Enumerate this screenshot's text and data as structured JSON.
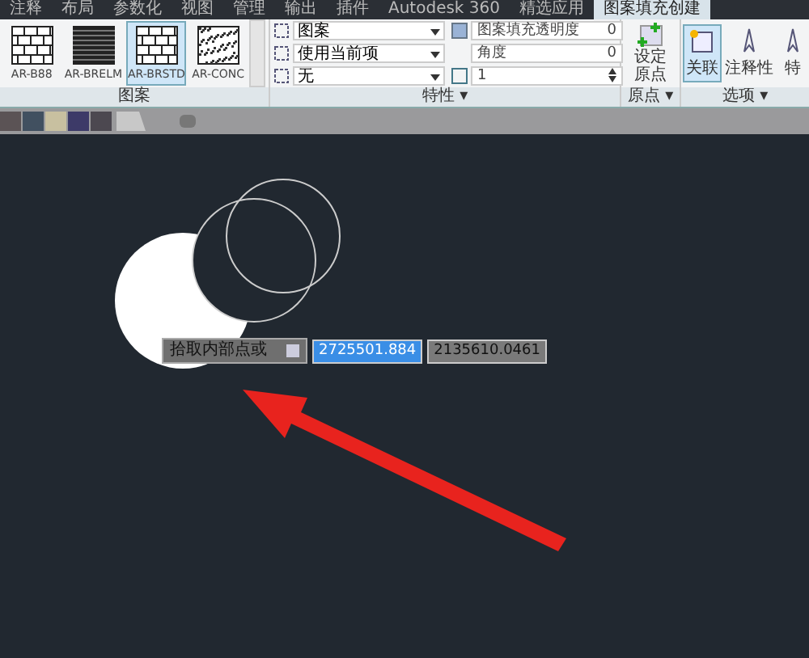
{
  "ribbon_tabs": [
    {
      "label": "注释",
      "selected": false
    },
    {
      "label": "布局",
      "selected": false
    },
    {
      "label": "参数化",
      "selected": false
    },
    {
      "label": "视图",
      "selected": false
    },
    {
      "label": "管理",
      "selected": false
    },
    {
      "label": "输出",
      "selected": false
    },
    {
      "label": "插件",
      "selected": false
    },
    {
      "label": "Autodesk 360",
      "selected": false
    },
    {
      "label": "精选应用",
      "selected": false
    },
    {
      "label": "图案填充创建",
      "selected": true
    }
  ],
  "pattern_panel": {
    "title": "图案",
    "patterns": [
      {
        "label": "AR-B88",
        "selected": false,
        "kind": "brick"
      },
      {
        "label": "AR-BRELM",
        "selected": false,
        "kind": "dense"
      },
      {
        "label": "AR-BRSTD",
        "selected": true,
        "kind": "brick"
      },
      {
        "label": "AR-CONC",
        "selected": false,
        "kind": "concrete"
      }
    ]
  },
  "properties_panel": {
    "title": "特性 ▾",
    "dropdowns": [
      "图案",
      "使用当前项",
      "无"
    ],
    "transparency_label": "图案填充透明度",
    "transparency_value": "0",
    "angle_label": "角度",
    "angle_value": "0",
    "scale_value": "1"
  },
  "origin_panel": {
    "title": "原点 ▾",
    "button": "设定原点"
  },
  "options_panel": {
    "title": "选项 ▾",
    "buttons": [
      {
        "label": "关联",
        "selected": true
      },
      {
        "label": "注释性",
        "selected": false
      },
      {
        "label": "特",
        "selected": false
      }
    ]
  },
  "command_input": {
    "prompt": "拾取内部点或",
    "x_value": "2725501.884",
    "y_value": "2135610.0461"
  }
}
